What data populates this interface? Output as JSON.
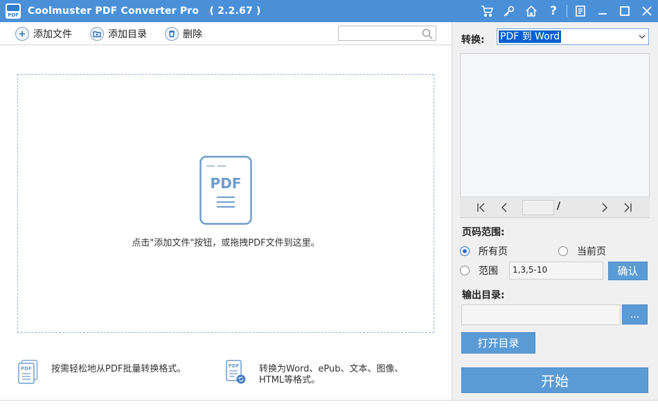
{
  "window": {
    "title": "Coolmuster PDF Converter Pro",
    "version": "( 2.2.67 )",
    "logo_text": "PDF"
  },
  "titlebar_icons": [
    "cart-icon",
    "key-icon",
    "home-icon",
    "help-icon",
    "register-icon",
    "minimize-icon",
    "maximize-icon",
    "close-icon"
  ],
  "titlebar_help": "?",
  "toolbar": {
    "add_file": "添加文件",
    "add_folder": "添加目录",
    "delete": "删除",
    "search_value": ""
  },
  "dropzone": {
    "doc_label": "PDF",
    "hint": "点击\"添加文件\"按钮，或拖拽PDF文件到这里。"
  },
  "features": [
    {
      "line1": "按需轻松地从PDF批量转换格式。",
      "line2": ""
    },
    {
      "line1": "转换为Word、ePub、文本、图像、",
      "line2": "HTML等格式。"
    }
  ],
  "right": {
    "convert_label": "转换:",
    "convert_value": "PDF 到 Word",
    "pager": {
      "current": "",
      "slash": "/"
    },
    "page_range_label": "页码范围:",
    "radio_all": "所有页",
    "radio_current": "当前页",
    "radio_range": "范围",
    "range_value": "1,3,5-10",
    "confirm": "确认",
    "output_label": "输出目录:",
    "output_value": "",
    "browse": "...",
    "open_folder": "打开目录",
    "start": "开始"
  },
  "colors": {
    "accent": "#4a90d9",
    "button": "#5b9bd5",
    "selection": "#0a5fd0"
  }
}
